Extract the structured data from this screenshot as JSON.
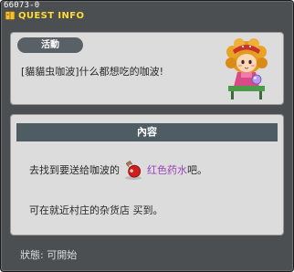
{
  "window": {
    "quest_id": "66073-0",
    "title": "QUEST INFO",
    "title_color": "#ffdd33"
  },
  "summary": {
    "badge": "活動",
    "quest_title": "[貓貓虫咖波]什么都想吃的咖波!",
    "npc": "npc-girl-portrait"
  },
  "content": {
    "header": "內容",
    "line1_prefix": "去找到要送给咖波的",
    "item_icon": "red-potion-icon",
    "item_name": "红色药水",
    "item_color": "#9a44b8",
    "line1_suffix": "吧。",
    "line2": "可在就近村庄的杂货店 买到。"
  },
  "status": {
    "text": "狀態:  可開始"
  }
}
